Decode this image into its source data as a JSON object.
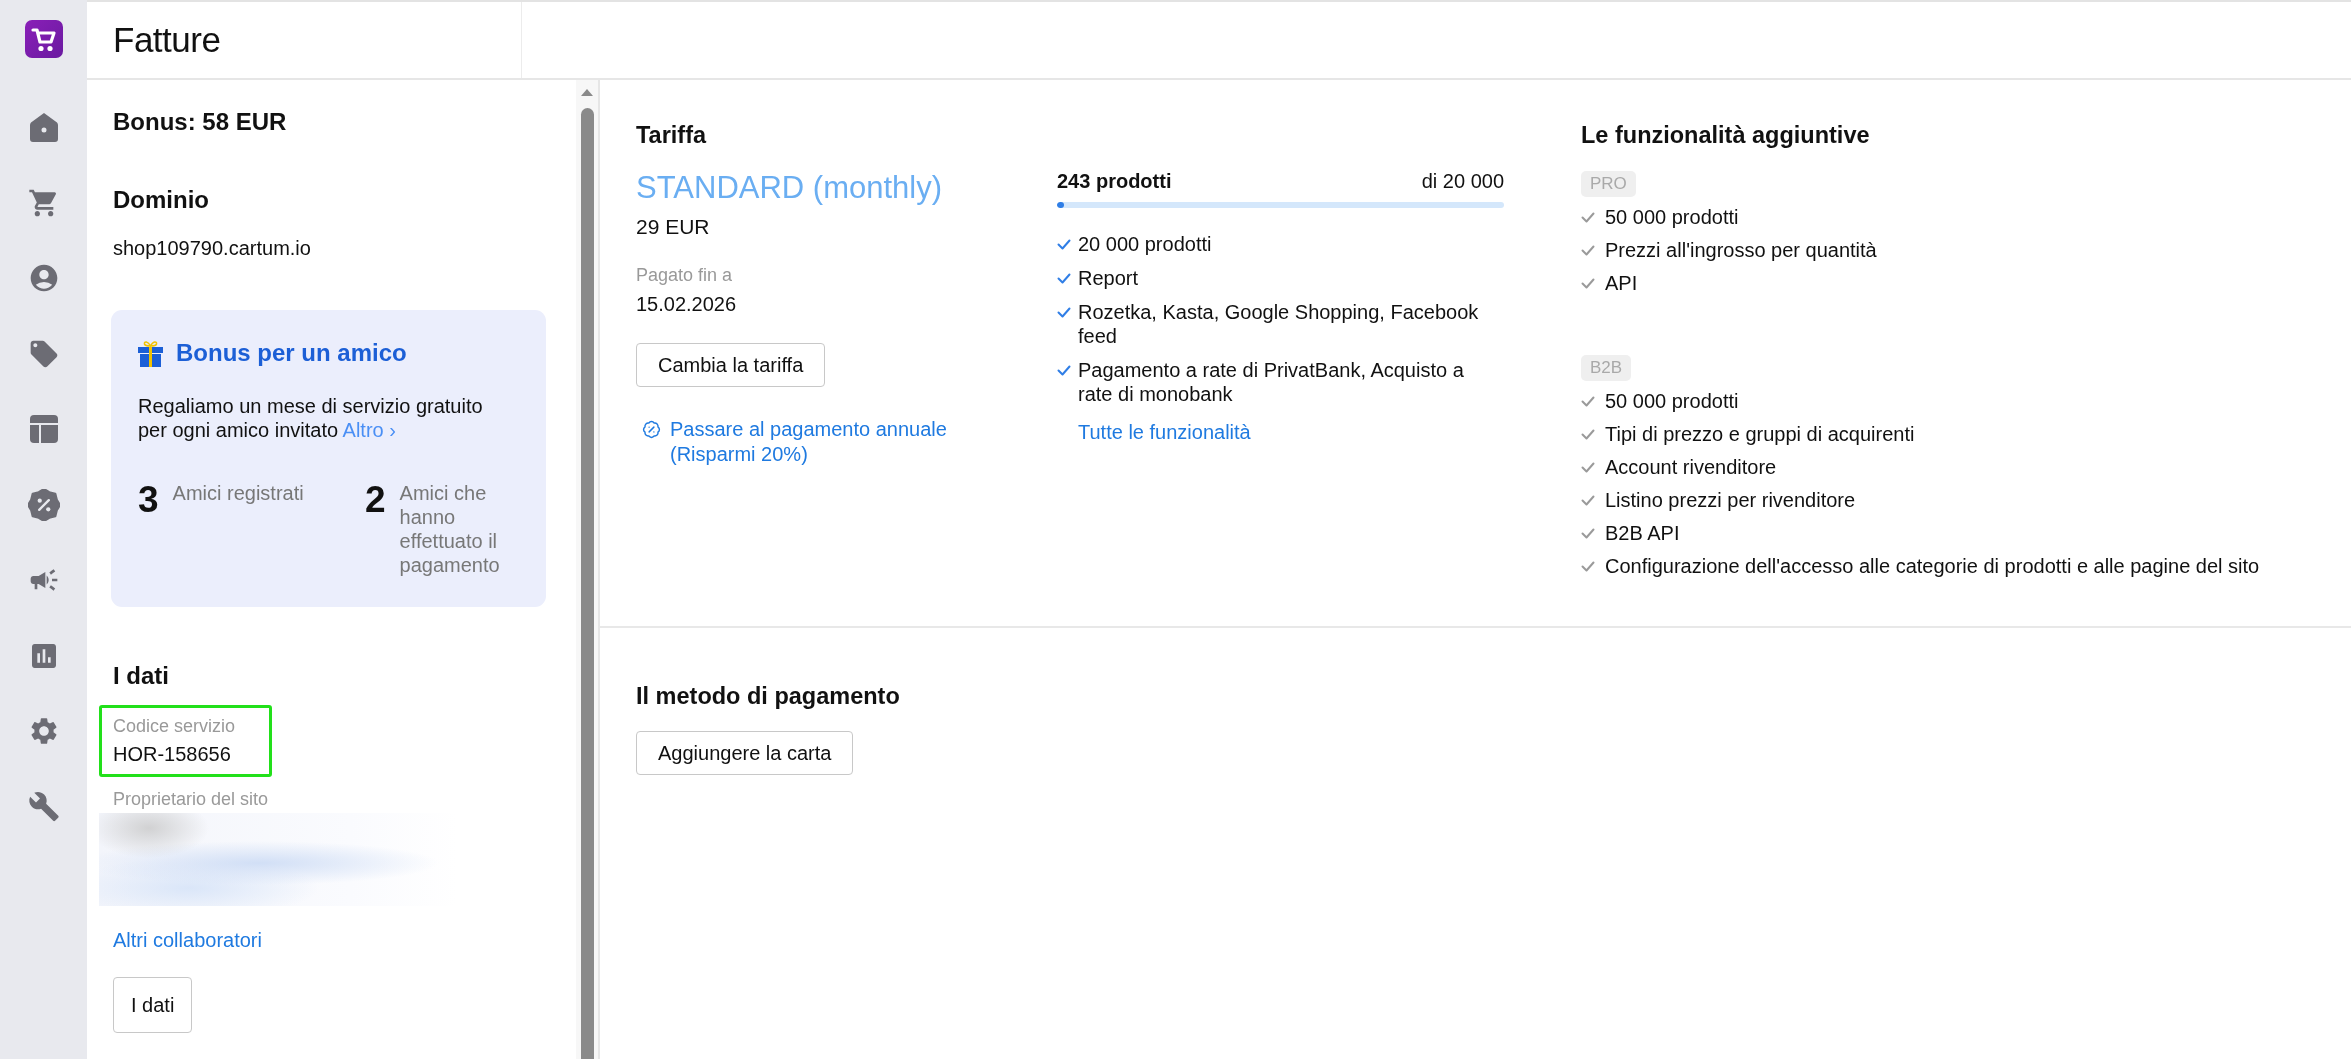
{
  "header": {
    "title": "Fatture"
  },
  "account": {
    "bonus": "Bonus: 58 EUR",
    "domain_heading": "Dominio",
    "domain": "shop109790.cartum.io"
  },
  "referral": {
    "title": "Bonus per un amico",
    "text": "Regaliamo un mese di servizio gratuito per ogni amico invitato",
    "link": "Altro ›",
    "stats": [
      {
        "value": "3",
        "label": "Amici registrati"
      },
      {
        "value": "2",
        "label": "Amici che hanno effettuato il pagamento"
      }
    ]
  },
  "details": {
    "heading": "I dati",
    "fields": [
      {
        "kind": "text",
        "label": "Codice servizio",
        "value": "HOR-158656",
        "highlighted": true
      },
      {
        "kind": "blurred",
        "label": "Proprietario del sito",
        "highlighted": false
      }
    ],
    "link": "Altri collaboratori",
    "button": "I dati"
  },
  "tariff": {
    "heading": "Tariffa",
    "plan": "STANDARD (monthly)",
    "price": "29 EUR",
    "paid_until_label": "Pagato fin a",
    "paid_until": "15.02.2026",
    "button": "Cambia la tariffa",
    "annual_link": "Passare al pagamento annuale (Risparmi 20%)"
  },
  "usage": {
    "count": "243 prodotti",
    "limit": "di 20 000",
    "level": 0.015,
    "features": [
      "20 000 prodotti",
      "Report",
      "Rozetka, Kasta, Google Shopping, Facebook feed",
      "Pagamento a rate di PrivatBank, Acquisto a rate di monobank"
    ],
    "link": "Tutte le funzionalità"
  },
  "addons": {
    "heading": "Le funzionalità aggiuntive",
    "groups": [
      {
        "badge": "PRO",
        "features": [
          "50 000 prodotti",
          "Prezzi all'ingrosso per quantità",
          "API"
        ]
      },
      {
        "badge": "B2B",
        "features": [
          "50 000 prodotti",
          "Tipi di prezzo e gruppi di acquirenti",
          "Account rivenditore",
          "Listino prezzi per rivenditore",
          "B2B API",
          "Configurazione dell'accesso alle categorie di prodotti e alle pagine del sito"
        ]
      }
    ]
  },
  "payment": {
    "heading": "Il metodo di pagamento",
    "button": "Aggiungere la carta"
  }
}
